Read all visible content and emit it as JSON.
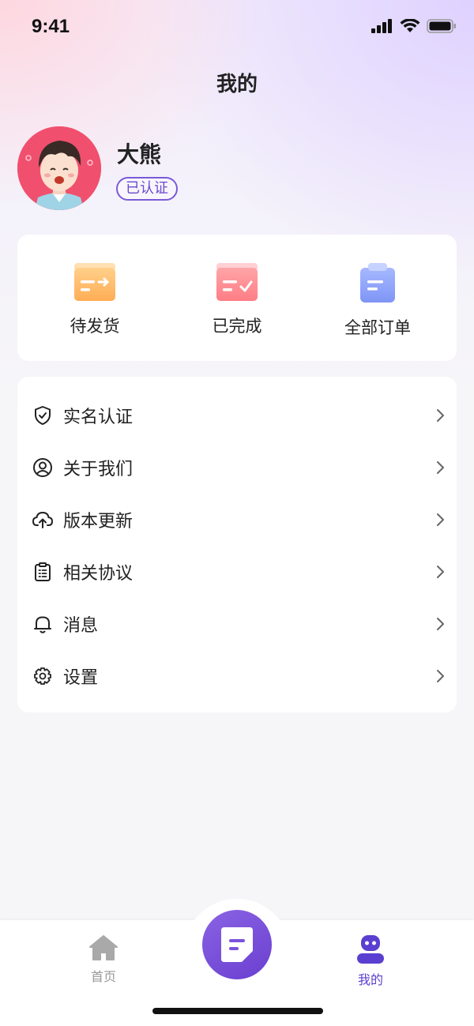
{
  "status_bar": {
    "time": "9:41"
  },
  "header": {
    "title": "我的"
  },
  "profile": {
    "name": "大熊",
    "badge": "已认证"
  },
  "orders": [
    {
      "label": "待发货",
      "icon": "pending-shipment-icon"
    },
    {
      "label": "已完成",
      "icon": "completed-icon"
    },
    {
      "label": "全部订单",
      "icon": "all-orders-icon"
    }
  ],
  "menu": [
    {
      "label": "实名认证",
      "icon": "shield-check-icon"
    },
    {
      "label": "关于我们",
      "icon": "user-circle-icon"
    },
    {
      "label": "版本更新",
      "icon": "cloud-upload-icon"
    },
    {
      "label": "相关协议",
      "icon": "clipboard-icon"
    },
    {
      "label": "消息",
      "icon": "bell-icon"
    },
    {
      "label": "设置",
      "icon": "gear-icon"
    }
  ],
  "tab_bar": {
    "home": {
      "label": "首页"
    },
    "mine": {
      "label": "我的"
    }
  },
  "colors": {
    "accent": "#6a49cf",
    "tab_inactive": "#999999",
    "avatar_bg": "#f0506e"
  }
}
